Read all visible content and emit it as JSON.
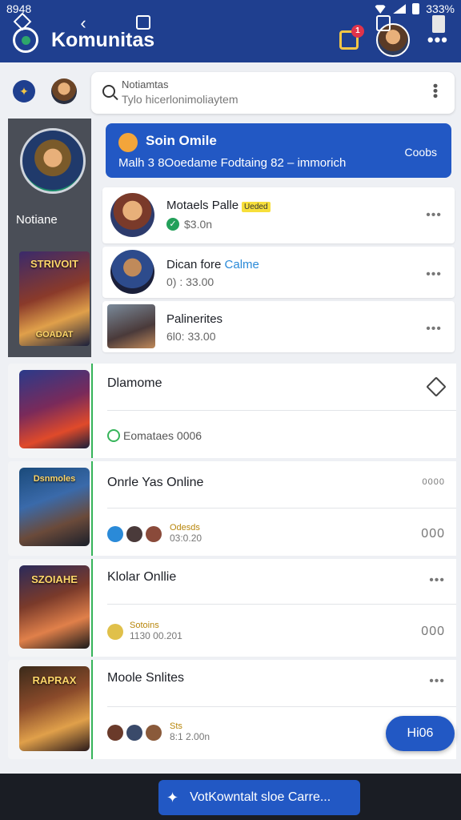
{
  "status_bar": {
    "time": "8948",
    "battery": "333%"
  },
  "app_bar": {
    "title": "Komunitas",
    "notification_count": "1",
    "more": "•••"
  },
  "search": {
    "label": "Notiamtas",
    "hint": "Tylo hicerlonimoliaytem",
    "more": "•••"
  },
  "left_panel": {
    "label": "Notiane",
    "cover_text_top": "STRIVOIT",
    "cover_text_bottom": "GOADAT"
  },
  "promo": {
    "title": "Soin Omile",
    "subtitle": "Malh 3 8Ooedame  Fodtaing 82  –  immorich",
    "action": "Coobs"
  },
  "top_items": [
    {
      "title": "Motaels Palle",
      "tag": "Ueded",
      "sub": "$3.0n",
      "more": "•••"
    },
    {
      "title": "Dican fore",
      "title_highlight": "Calme",
      "sub": "0) : 33.00",
      "more": "•••"
    },
    {
      "title": "Palinerites",
      "sub": "6l0: 33.00",
      "more": "•••"
    }
  ],
  "rows": [
    {
      "cover_text": "",
      "title": "Dlamome",
      "sub": "Eomataes 0006",
      "icon": "pin-icon"
    },
    {
      "cover_text": "Dsnmoles",
      "title": "Onrle  Yas Online",
      "right_text": "0000",
      "avatars_tag": "Odesds",
      "avatars_sub": "03:0.20",
      "more": "000"
    },
    {
      "cover_text": "SZOIAHE",
      "title": "Klolar Onllie",
      "avatars_tag": "Sotoins",
      "avatars_sub": "1130 00.201",
      "more": "000"
    },
    {
      "cover_text": "RAPRAX",
      "title": "Moole Snlites",
      "avatars_tag": "Sts",
      "avatars_sub": "8:1 2.00n",
      "more": "•••"
    }
  ],
  "fab": {
    "label": "Hi06"
  },
  "bottom_bar": {
    "pill_label": "VotKowntalt sloe Carre..."
  },
  "colors": {
    "primary": "#1f3f8f",
    "accent": "#2258c4",
    "green": "#36b45a"
  }
}
